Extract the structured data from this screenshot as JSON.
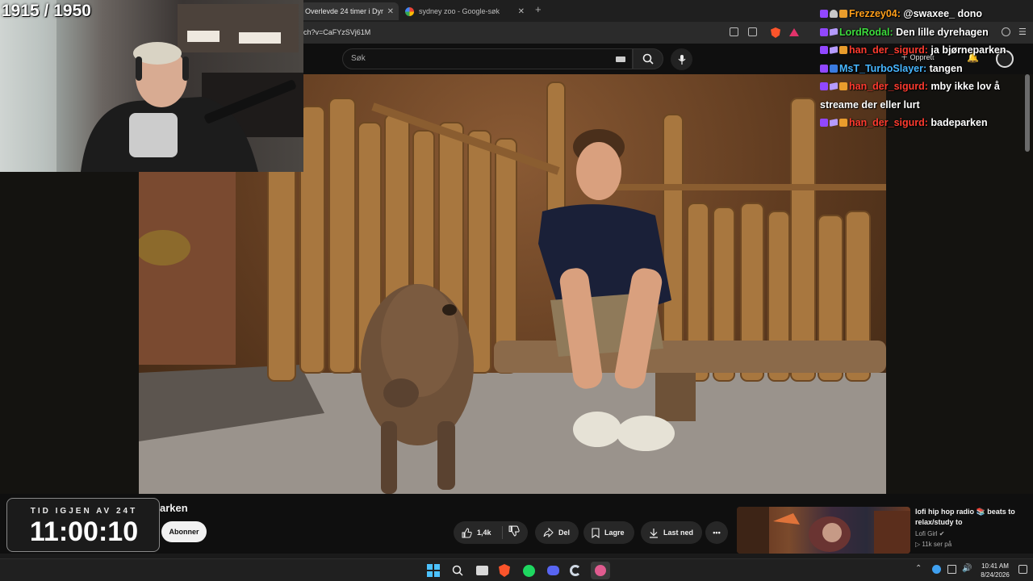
{
  "browser": {
    "tabs": [
      {
        "label": "Overlevde 24 timer i Dyr",
        "active": true
      },
      {
        "label": "sydney zoo - Google-søk",
        "active": false
      }
    ],
    "url": "ch?v=CaFYzSVj61M"
  },
  "youtube": {
    "search_placeholder": "Søk",
    "create_label": "Opprett"
  },
  "stream": {
    "viewer_count": "1915 / 1950",
    "timer_label": "TID IGJEN AV 24T",
    "timer_value": "11:00:10"
  },
  "chat": [
    {
      "user": "Frezzey04",
      "user_color": "#ff9f1a",
      "badges": [
        "purple",
        "ghost",
        "gift"
      ],
      "text": "@swaxee_ dono"
    },
    {
      "user": "LordRodal",
      "user_color": "#3ddc3d",
      "badges": [
        "purple",
        "stack"
      ],
      "text": "Den lille dyrehagen"
    },
    {
      "user": "han_der_sigurd",
      "user_color": "#ff3b2f",
      "badges": [
        "purple",
        "stack",
        "gift"
      ],
      "text": "ja bjørneparken"
    },
    {
      "user": "MsT_TurboSlayer",
      "user_color": "#47b6ff",
      "badges": [
        "purple",
        "yt"
      ],
      "text": "tangen"
    },
    {
      "user": "han_der_sigurd",
      "user_color": "#ff3b2f",
      "badges": [
        "purple",
        "stack",
        "gift"
      ],
      "text": "mby ikke lov å streame der eller lurt"
    },
    {
      "user": "han_der_sigurd",
      "user_color": "#ff3b2f",
      "badges": [
        "purple",
        "stack",
        "gift"
      ],
      "text": "badeparken"
    }
  ],
  "video": {
    "title_visible": "arken",
    "subscribe_label": "Abonner",
    "likes": "1,4k",
    "share_label": "Del",
    "save_label": "Lagre",
    "download_label": "Last ned"
  },
  "recommendation": {
    "title": "lofi hip hop radio 📚 beats to relax/study to",
    "channel": "Lofi Girl",
    "views": "▷ 11k ser på"
  },
  "taskbar": {
    "time": "10:41 AM",
    "date": "8/24/2026",
    "icons": [
      "windows-start-icon",
      "search-icon",
      "file-explorer-icon",
      "brave-browser-icon",
      "spotify-icon",
      "discord-icon",
      "ccleaner-icon",
      "steam-icon"
    ]
  }
}
